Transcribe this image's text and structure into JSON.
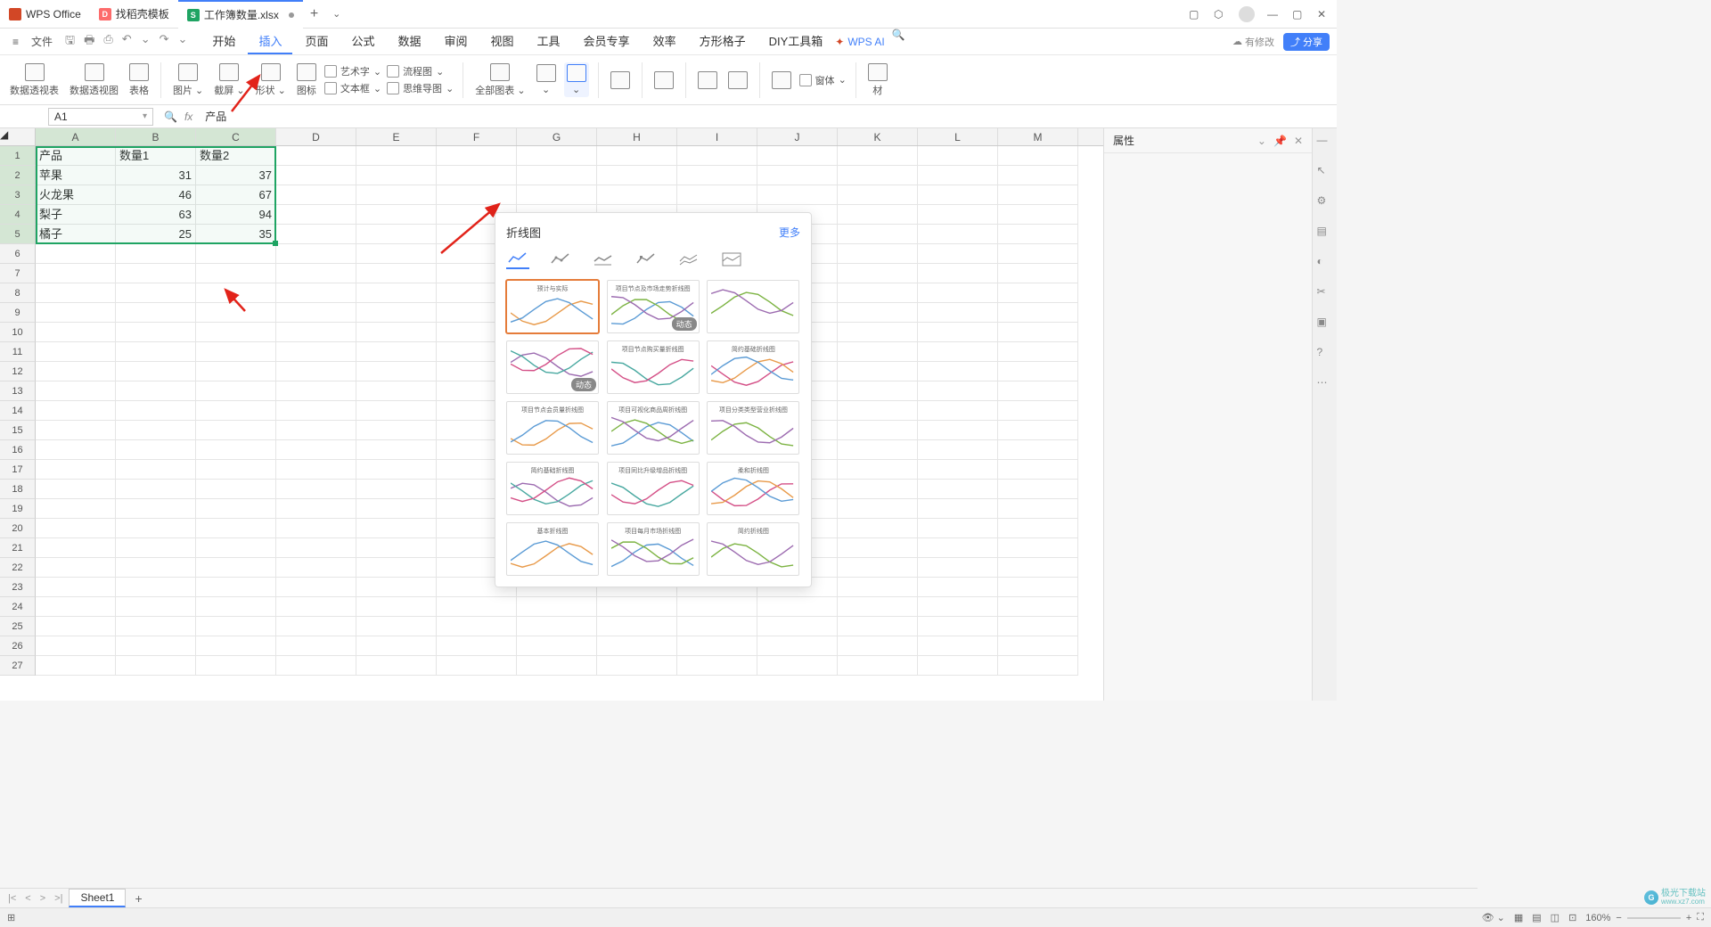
{
  "titlebar": {
    "tabs": [
      {
        "icon": "wps",
        "label": "WPS Office"
      },
      {
        "icon": "d",
        "label": "找稻壳模板"
      },
      {
        "icon": "s",
        "label": "工作簿数量.xlsx",
        "active": true,
        "dirty": true
      }
    ]
  },
  "menubar": {
    "file": "文件",
    "tabs": [
      "开始",
      "插入",
      "页面",
      "公式",
      "数据",
      "审阅",
      "视图",
      "工具",
      "会员专享",
      "效率",
      "方形格子",
      "DIY工具箱"
    ],
    "active_tab": "插入",
    "wps_ai": "WPS AI",
    "pending": "有修改",
    "share": "分享"
  },
  "ribbon": {
    "groups": [
      "数据透视表",
      "数据透视图",
      "表格",
      "图片",
      "截屏",
      "形状",
      "图标",
      "全部图表"
    ],
    "mini": {
      "wordart": "艺术字",
      "flowchart": "流程图",
      "textbox": "文本框",
      "mindmap": "思维导图"
    },
    "right": {
      "material": "材",
      "form": "窗体"
    }
  },
  "formula_bar": {
    "name_box": "A1",
    "fx": "fx",
    "value": "产品"
  },
  "columns": [
    "A",
    "B",
    "C",
    "D",
    "E",
    "F",
    "G",
    "H",
    "I",
    "J",
    "K",
    "L",
    "M"
  ],
  "grid": {
    "rows": [
      [
        "产品",
        "数量1",
        "数量2"
      ],
      [
        "苹果",
        "31",
        "37"
      ],
      [
        "火龙果",
        "46",
        "67"
      ],
      [
        "梨子",
        "63",
        "94"
      ],
      [
        "橘子",
        "25",
        "35"
      ]
    ],
    "selection": {
      "r1": 1,
      "c1": 1,
      "r2": 5,
      "c2": 3
    }
  },
  "chart_dropdown": {
    "title": "折线图",
    "more": "更多",
    "dynamic_badge": "动态",
    "thumbs": [
      {
        "title": "预计与实际"
      },
      {
        "title": "项目节点及市场走势折线图",
        "badge": true
      },
      {
        "title": "",
        "badge": false
      },
      {
        "title": "",
        "badge": true
      },
      {
        "title": "项目节点购买量折线图"
      },
      {
        "title": "简约基础折线图"
      },
      {
        "title": "项目节点会员量折线图"
      },
      {
        "title": "项目可视化商品周折线图"
      },
      {
        "title": "项目分类类型营业折线图"
      },
      {
        "title": "简约基础折线图"
      },
      {
        "title": "项目同比升级增品折线图"
      },
      {
        "title": "柔和折线图"
      },
      {
        "title": "基本折线图"
      },
      {
        "title": "项目每月市场折线图"
      },
      {
        "title": "简约折线图"
      }
    ]
  },
  "right_panel": {
    "title": "属性"
  },
  "sheet_tabs": {
    "active": "Sheet1"
  },
  "statusbar": {
    "zoom": "160%"
  },
  "watermark": {
    "name": "极光下载站",
    "url": "www.xz7.com"
  }
}
